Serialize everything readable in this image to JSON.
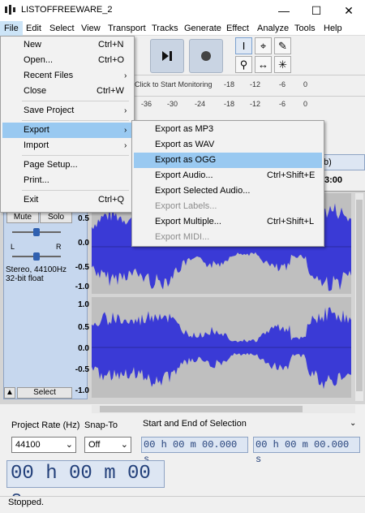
{
  "window": {
    "title": "LISTOFFREEWARE_2",
    "minimize": "—",
    "maximize": "☐",
    "close": "✕"
  },
  "menubar": [
    "File",
    "Edit",
    "Select",
    "View",
    "Transport",
    "Tracks",
    "Generate",
    "Effect",
    "Analyze",
    "Tools",
    "Help"
  ],
  "file_menu": {
    "items": [
      {
        "label": "New",
        "shortcut": "Ctrl+N"
      },
      {
        "label": "Open...",
        "shortcut": "Ctrl+O"
      },
      {
        "label": "Recent Files",
        "submenu": true
      },
      {
        "label": "Close",
        "shortcut": "Ctrl+W"
      },
      {
        "label": "Save Project",
        "submenu": true
      },
      {
        "label": "Export",
        "submenu": true,
        "highlighted": true
      },
      {
        "label": "Import",
        "submenu": true
      },
      {
        "label": "Page Setup..."
      },
      {
        "label": "Print..."
      },
      {
        "label": "Exit",
        "shortcut": "Ctrl+Q"
      }
    ]
  },
  "export_menu": {
    "items": [
      {
        "label": "Export as MP3",
        "shortcut": ""
      },
      {
        "label": "Export as WAV",
        "shortcut": ""
      },
      {
        "label": "Export as OGG",
        "shortcut": "",
        "highlighted": true
      },
      {
        "label": "Export Audio...",
        "shortcut": "Ctrl+Shift+E"
      },
      {
        "label": "Export Selected Audio...",
        "shortcut": ""
      },
      {
        "label": "Export Labels...",
        "shortcut": "",
        "disabled": true
      },
      {
        "label": "Export Multiple...",
        "shortcut": "Ctrl+Shift+L"
      },
      {
        "label": "Export MIDI...",
        "shortcut": "",
        "disabled": true
      }
    ]
  },
  "toolbar": {
    "monitor_text": "Click to Start Monitoring",
    "meter_top": [
      "-18",
      "-12",
      "-6",
      "0"
    ],
    "meter_bottom": [
      "-36",
      "-30",
      "-24",
      "-18",
      "-12",
      "-6",
      "0"
    ],
    "recording_label": "b) Recordin",
    "ruler_value": "3:00",
    "icons": [
      "skip-end-icon",
      "record-icon",
      "select-tool-icon",
      "envelope-tool-icon",
      "draw-tool-icon",
      "zoom-tool-icon",
      "timeshift-tool-icon",
      "multi-tool-icon"
    ]
  },
  "track": {
    "mute": "Mute",
    "solo": "Solo",
    "pan_left": "L",
    "pan_right": "R",
    "format": "Stereo, 44100Hz",
    "bit": "32-bit float",
    "select": "Select",
    "collapse": "▲",
    "scale_top": [
      "0.5",
      "0.0",
      "-0.5",
      "-1.0"
    ],
    "scale_bottom": [
      "1.0",
      "0.5",
      "0.0",
      "-0.5",
      "-1.0"
    ]
  },
  "bottom": {
    "project_rate_label": "Project Rate (Hz)",
    "snap_to_label": "Snap-To",
    "selection_label": "Start and End of Selection",
    "project_rate_value": "44100",
    "snap_to_value": "Off",
    "start_time": "00 h 00 m 00.000 s",
    "end_time": "00 h 00 m 00.000 s",
    "big_time": "00 h 00 m 00 s"
  },
  "status": "Stopped.",
  "colors": {
    "wave": "#3a3ad6",
    "highlight": "#99c9f1",
    "track_panel": "#c6d7ee"
  }
}
